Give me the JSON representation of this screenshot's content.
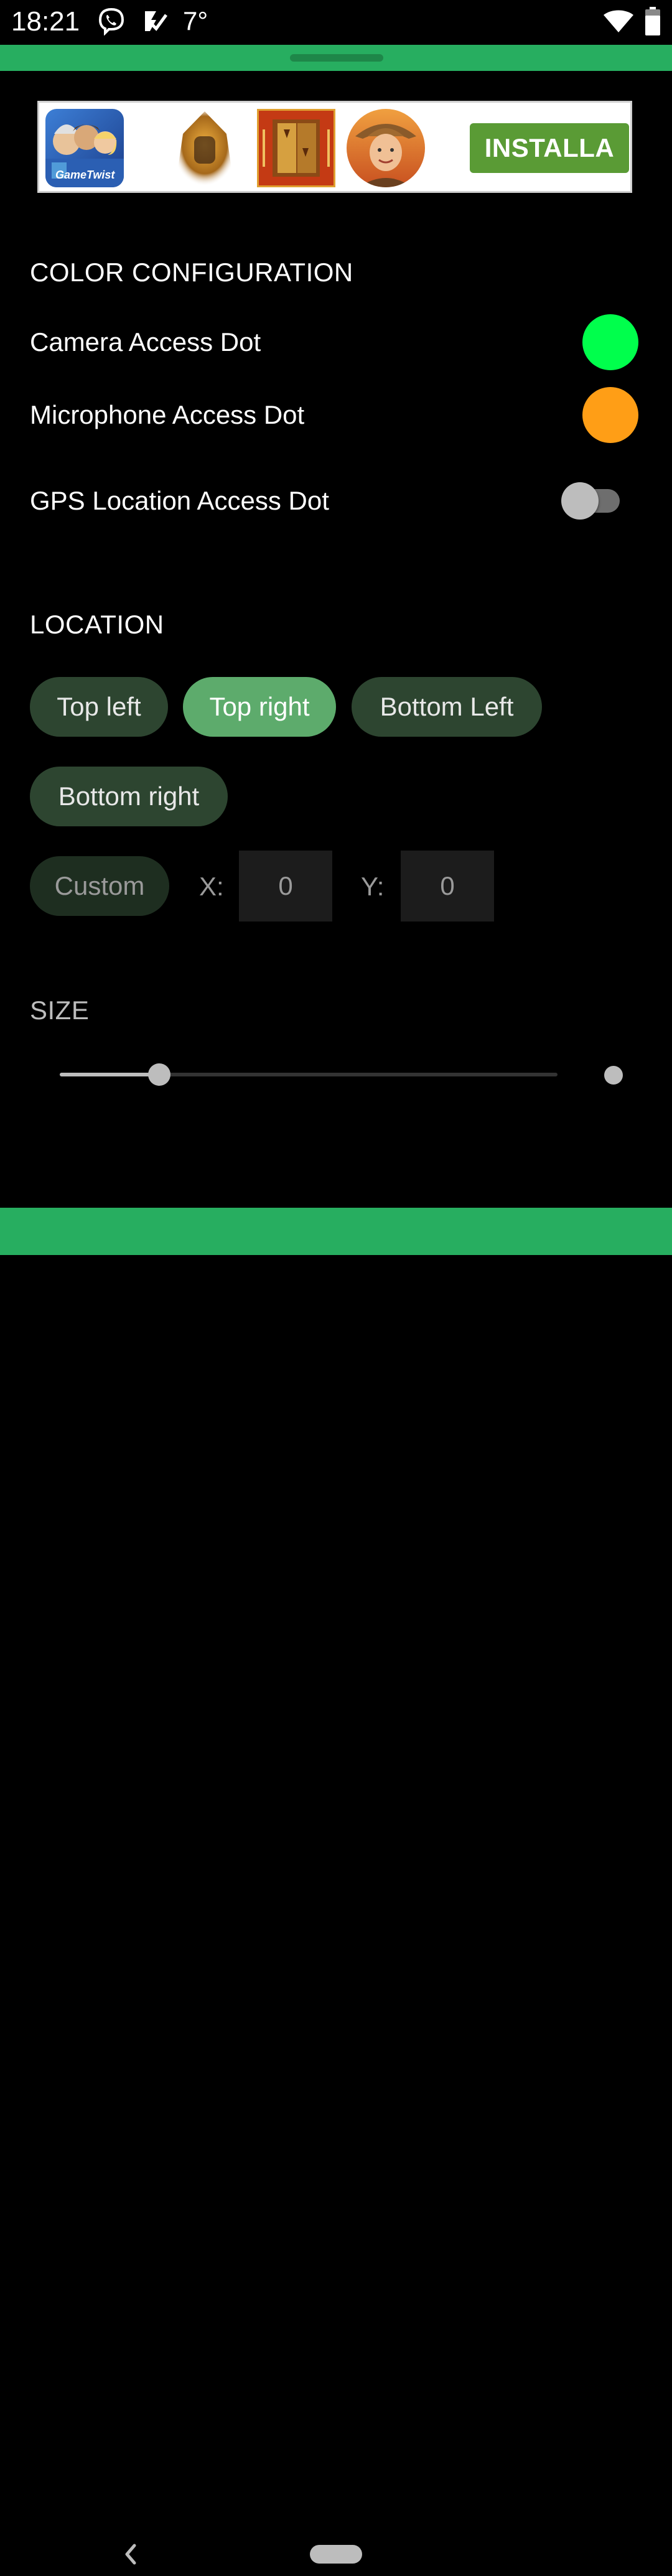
{
  "status_bar": {
    "time": "18:21",
    "temperature": "7°",
    "icons": [
      "viber-icon",
      "check-icon",
      "wifi-icon",
      "battery-icon"
    ]
  },
  "ad": {
    "brand_text": "GameTwist",
    "install_label": "INSTALLA"
  },
  "color_configuration": {
    "title": "COLOR CONFIGURATION",
    "camera_label": "Camera Access Dot",
    "camera_color": "#00ff4c",
    "microphone_label": "Microphone Access Dot",
    "microphone_color": "#ff9e16",
    "gps_label": "GPS Location Access Dot",
    "gps_enabled": false
  },
  "location": {
    "title": "LOCATION",
    "options": [
      "Top left",
      "Top right",
      "Bottom Left",
      "Bottom right"
    ],
    "selected": "Top right",
    "custom_label": "Custom",
    "x_label": "X:",
    "x_value": "0",
    "y_label": "Y:",
    "y_value": "0"
  },
  "size": {
    "title": "SIZE",
    "value_fraction": 0.2
  },
  "colors": {
    "accent_green": "#27ae60",
    "chip_bg": "#2d4530",
    "chip_selected": "#5dab6c"
  }
}
